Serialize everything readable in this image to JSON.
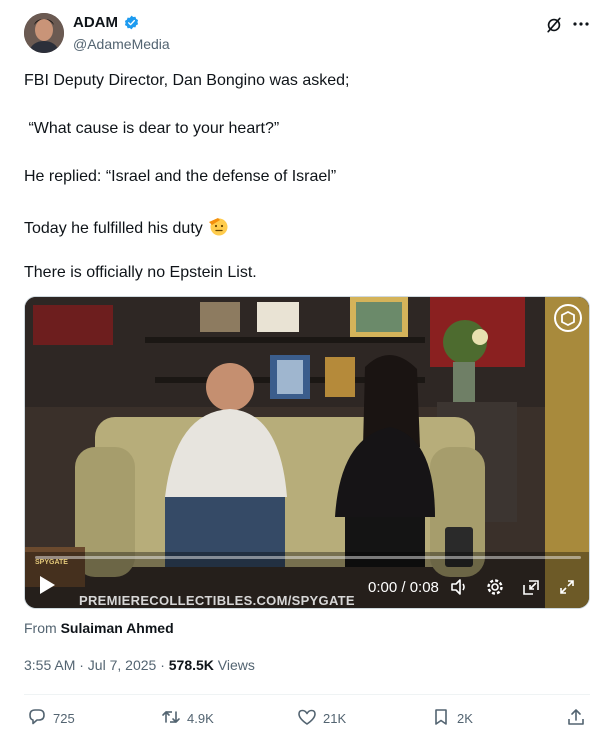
{
  "author": {
    "name": "ADAM",
    "handle": "@AdameMedia"
  },
  "post": {
    "lines": [
      "FBI Deputy Director, Dan Bongino was asked;",
      " “What cause is dear to your heart?”",
      "He replied: “Israel and the defense of Israel”",
      "Today he fulfilled his duty",
      "There is officially no Epstein List."
    ],
    "emoji": "saluting-face-emoji"
  },
  "video": {
    "time": "0:00 / 0:08",
    "watermark": "PREMIERECOLLECTIBLES.COM/SPYGATE",
    "badge": "SPYGATE"
  },
  "attribution": {
    "prefix": "From",
    "source": "Sulaiman Ahmed"
  },
  "meta": {
    "time": "3:55 AM · Jul 7, 2025 ·",
    "views_count": "578.5K",
    "views_label": "Views"
  },
  "actions": {
    "replies": "725",
    "reposts": "4.9K",
    "likes": "21K",
    "bookmarks": "2K"
  },
  "colors": {
    "verified": "#1d9bf0",
    "text": "#0f1419",
    "secondary": "#536471"
  }
}
